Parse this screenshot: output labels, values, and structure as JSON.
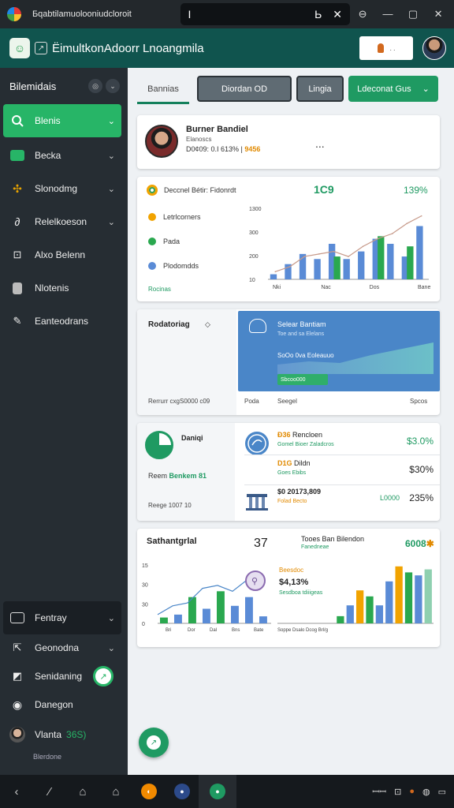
{
  "window": {
    "title": "Бqabtilamuolooniudcloroit",
    "tab_text": "I",
    "tab_extra": "Ь",
    "controls": [
      "⊖",
      "—",
      "▢",
      "✕"
    ]
  },
  "header": {
    "app_title": "ËimultkonAdoorr Lnoangmila",
    "button_label": ". .",
    "colors": {
      "bar": "#10544e",
      "accent": "#1f9a62"
    }
  },
  "sidebar": {
    "heading": "Bilemidais",
    "items": [
      {
        "label": "Blenis",
        "icon": "search-icon",
        "active": true
      },
      {
        "label": "Becka",
        "icon": "green-square-icon"
      },
      {
        "label": "Slonodmg",
        "icon": "puzzle-icon"
      },
      {
        "label": "Relelkoeson",
        "icon": "link-icon"
      },
      {
        "label": "Alxo Belenn",
        "icon": "image-icon"
      },
      {
        "label": "Nlotenis",
        "icon": "document-icon"
      },
      {
        "label": "Eanteodrans",
        "icon": "pen-icon"
      }
    ],
    "bottom_items": [
      {
        "label": "Fentray",
        "icon": "tray-icon"
      },
      {
        "label": "Geonodna",
        "icon": "export-icon"
      },
      {
        "label": "Senidaning",
        "icon": "folder-icon"
      },
      {
        "label": "Danegon",
        "icon": "disc-icon"
      }
    ],
    "user": {
      "name": "Vlanta",
      "meta": "36S)"
    },
    "footer": "Blerdone"
  },
  "topbar": {
    "tabs": [
      "Bannias",
      "Diordan OD",
      "Lingia",
      "Ldeconat Gus"
    ]
  },
  "profile": {
    "name": "Burner Bandiel",
    "subtitle": "Elanoscs",
    "meta": "D0¢09: 0.I 613% |",
    "meta_highlight": "9456",
    "more": "..."
  },
  "chart_card": {
    "title": "Deccnel Bétir: Fidonrdt",
    "stat1": "1C9",
    "stat2": "139%",
    "legend": [
      {
        "label": "Letrlcorners",
        "color": "#f1a300"
      },
      {
        "label": "Pada",
        "color": "#2aa84f"
      },
      {
        "label": "Plodomdds",
        "color": "#5a8bd6"
      }
    ],
    "footer": "Rocinas"
  },
  "chart_data": {
    "type": "bar",
    "categories": [
      "",
      "",
      "",
      "",
      "",
      "",
      "",
      "",
      "",
      "",
      ""
    ],
    "x_tick_labels": [
      "Nki",
      "Nac",
      "Dos",
      "Bane"
    ],
    "y_tick_labels": [
      "1300",
      "300",
      "200",
      "10"
    ],
    "series": [
      {
        "values": [
          2,
          6,
          10,
          8,
          14,
          8,
          11,
          16,
          14,
          9,
          21
        ],
        "color": "#5a8bd6"
      },
      {
        "values": [
          0,
          0,
          0,
          0,
          9,
          0,
          0,
          17,
          0,
          13,
          0
        ],
        "color": "#2aa84f"
      }
    ],
    "line": [
      3,
      5,
      9,
      10,
      11,
      9,
      13,
      16,
      18,
      22,
      25
    ],
    "ylim": [
      0,
      28
    ],
    "grid": false
  },
  "report": {
    "title": "Rodatoriag",
    "chev": "◇",
    "blue": {
      "title": "Selear Bantiam",
      "sub": "Toe and sa Elelans",
      "mid": "SoOo 0va Eoleauuo",
      "pill": "Sbcoo000"
    },
    "footer": [
      "Rerrurr cxgS0000 c09",
      "Poda",
      "Seegel",
      "Spcos"
    ]
  },
  "stats": {
    "label1": "Daniqi",
    "line2_prefix": "Reem",
    "line2_main": "Benkem  81",
    "line3": "Reege 1007         10",
    "rows": [
      {
        "title_o": "Ð36",
        "title": "Rencloen",
        "sub": "Gomel Bioer Zaladcros",
        "val": "$3.0%",
        "green": true
      },
      {
        "title_o": "D1G",
        "title": "Dildn",
        "sub": "Goes Ebibs",
        "val": "$30%",
        "green": false
      },
      {
        "title_o": "",
        "title": "$0 20173,809",
        "sub": "Folad Becto",
        "val": "235%",
        "val2": "L0000",
        "green": false
      }
    ]
  },
  "bottom": {
    "title": "Sathantgrlal",
    "val": "37",
    "right_title": "Tooes Ban Bilendon",
    "right_sub": "Fanedneae",
    "right_val": "6008",
    "right_val_suffix": "",
    "l_y_ticks": [
      "15",
      "30",
      "30",
      "0"
    ],
    "l_x_ticks": [
      "Bri",
      "Dor",
      "Dal",
      "Bns",
      "Bate"
    ],
    "r_lbl1": "Beesdoc",
    "r_lbl2": "$4,13%",
    "r_lbl3": "Sesdboa tdiiigeas",
    "r_x_ticks": "Soppe Dsalo  Dcog  Brl/g"
  }
}
